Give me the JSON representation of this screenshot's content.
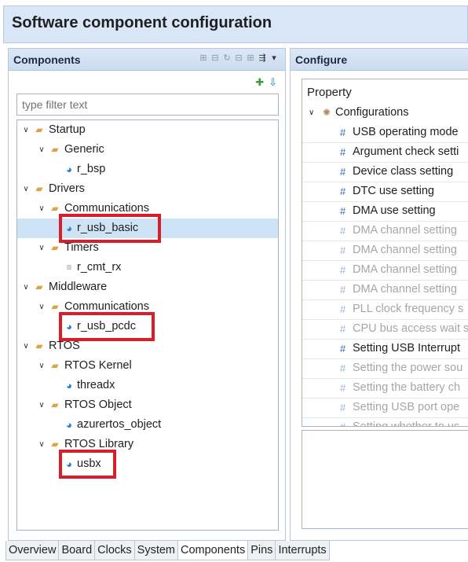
{
  "window": {
    "title": "Software component configuration"
  },
  "components_panel": {
    "title": "Components",
    "toolbar_icons": [
      "add-component-icon",
      "remove-component-icon",
      "refresh-icon",
      "collapse-all-icon",
      "expand-all-icon",
      "filter-icon",
      "view-menu-icon"
    ],
    "sub_icons": [
      "add-icon",
      "import-icon"
    ],
    "filter_placeholder": "type filter text",
    "tree": [
      {
        "label": "Startup",
        "level": 0,
        "type": "folder",
        "expanded": true
      },
      {
        "label": "Generic",
        "level": 1,
        "type": "folder",
        "expanded": true
      },
      {
        "label": "r_bsp",
        "level": 2,
        "type": "component"
      },
      {
        "label": "Drivers",
        "level": 0,
        "type": "folder",
        "expanded": true
      },
      {
        "label": "Communications",
        "level": 1,
        "type": "folder",
        "expanded": true
      },
      {
        "label": "r_usb_basic",
        "level": 2,
        "type": "component",
        "selected": true,
        "highlighted": true
      },
      {
        "label": "Timers",
        "level": 1,
        "type": "folder",
        "expanded": true
      },
      {
        "label": "r_cmt_rx",
        "level": 2,
        "type": "component-grey"
      },
      {
        "label": "Middleware",
        "level": 0,
        "type": "folder",
        "expanded": true
      },
      {
        "label": "Communications",
        "level": 1,
        "type": "folder",
        "expanded": true
      },
      {
        "label": "r_usb_pcdc",
        "level": 2,
        "type": "component",
        "highlighted": true
      },
      {
        "label": "RTOS",
        "level": 0,
        "type": "folder",
        "expanded": true
      },
      {
        "label": "RTOS Kernel",
        "level": 1,
        "type": "folder",
        "expanded": true
      },
      {
        "label": "threadx",
        "level": 2,
        "type": "component"
      },
      {
        "label": "RTOS Object",
        "level": 1,
        "type": "folder",
        "expanded": true
      },
      {
        "label": "azurertos_object",
        "level": 2,
        "type": "component"
      },
      {
        "label": "RTOS Library",
        "level": 1,
        "type": "folder",
        "expanded": true
      },
      {
        "label": "usbx",
        "level": 2,
        "type": "component",
        "highlighted": true
      }
    ]
  },
  "configure_panel": {
    "title": "Configure",
    "property_header": "Property",
    "configurations_label": "Configurations",
    "properties": [
      {
        "label": "USB operating mode",
        "enabled": true
      },
      {
        "label": "Argument check setti",
        "enabled": true
      },
      {
        "label": "Device class setting",
        "enabled": true
      },
      {
        "label": "DTC use setting",
        "enabled": true
      },
      {
        "label": "DMA use setting",
        "enabled": true
      },
      {
        "label": "DMA channel setting",
        "enabled": false
      },
      {
        "label": "DMA channel setting",
        "enabled": false
      },
      {
        "label": "DMA channel setting",
        "enabled": false
      },
      {
        "label": "DMA channel setting",
        "enabled": false
      },
      {
        "label": "PLL clock frequency s",
        "enabled": false
      },
      {
        "label": "CPU bus access wait s",
        "enabled": false
      },
      {
        "label": "Setting USB Interrupt",
        "enabled": true
      },
      {
        "label": "Setting the power sou",
        "enabled": false
      },
      {
        "label": "Setting the battery ch",
        "enabled": false
      },
      {
        "label": "Setting USB port ope",
        "enabled": false
      },
      {
        "label": "Setting whether to us",
        "enabled": false
      }
    ]
  },
  "tabs": [
    {
      "label": "Overview",
      "active": false
    },
    {
      "label": "Board",
      "active": false
    },
    {
      "label": "Clocks",
      "active": false
    },
    {
      "label": "System",
      "active": false
    },
    {
      "label": "Components",
      "active": true
    },
    {
      "label": "Pins",
      "active": false
    },
    {
      "label": "Interrupts",
      "active": false
    }
  ],
  "colors": {
    "highlight": "#d81e28",
    "selection": "#cfe3f7",
    "header": "#d8e6f8"
  }
}
